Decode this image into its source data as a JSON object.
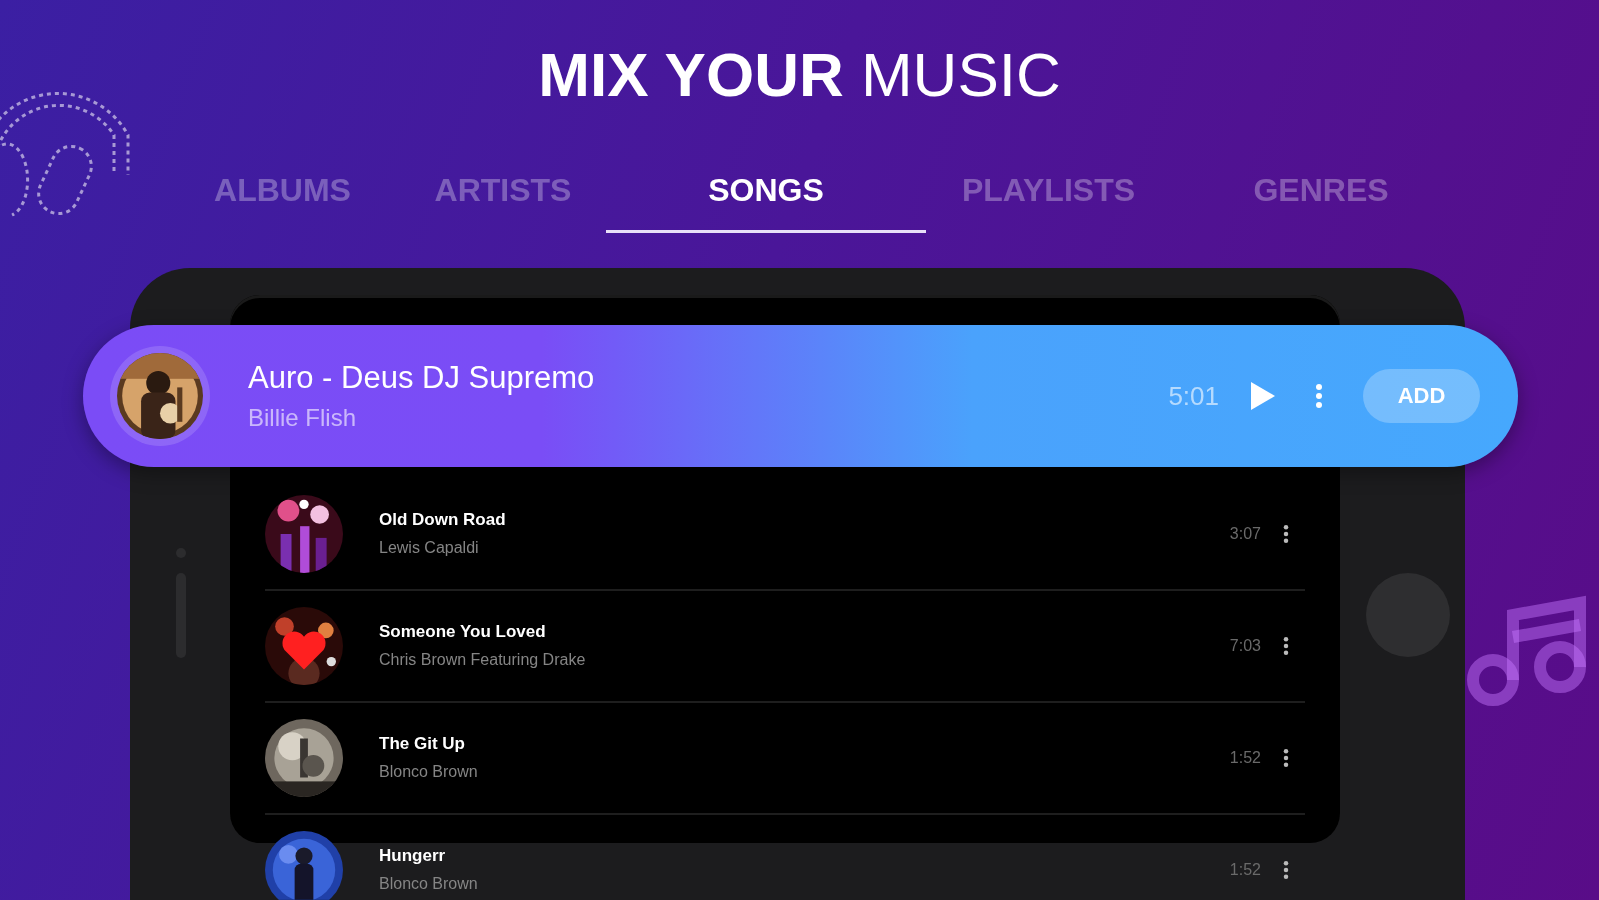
{
  "heading": "**MIX YOUR** MUSIC",
  "tabs": [
    {
      "label": "ALBUMS",
      "selected": false
    },
    {
      "label": "ARTISTS",
      "selected": false
    },
    {
      "label": "SONGS",
      "selected": true
    },
    {
      "label": "PLAYLISTS",
      "selected": false
    },
    {
      "label": "GENRES",
      "selected": false
    }
  ],
  "now_playing": {
    "title": "Auro - Deus DJ Supremo",
    "artist": "Billie Flish",
    "duration": "5:01",
    "button": "ADD"
  },
  "songs": [
    {
      "title": "Old Down Road",
      "artist": "Lewis Capaldi",
      "duration": "3:07"
    },
    {
      "title": "Someone You Loved",
      "artist": "Chris Brown Featuring Drake",
      "duration": "7:03"
    },
    {
      "title": "The Git Up",
      "artist": "Blonco Brown",
      "duration": "1:52"
    },
    {
      "title": "Hungerr",
      "artist": "Blonco Brown",
      "duration": "1:52"
    }
  ]
}
